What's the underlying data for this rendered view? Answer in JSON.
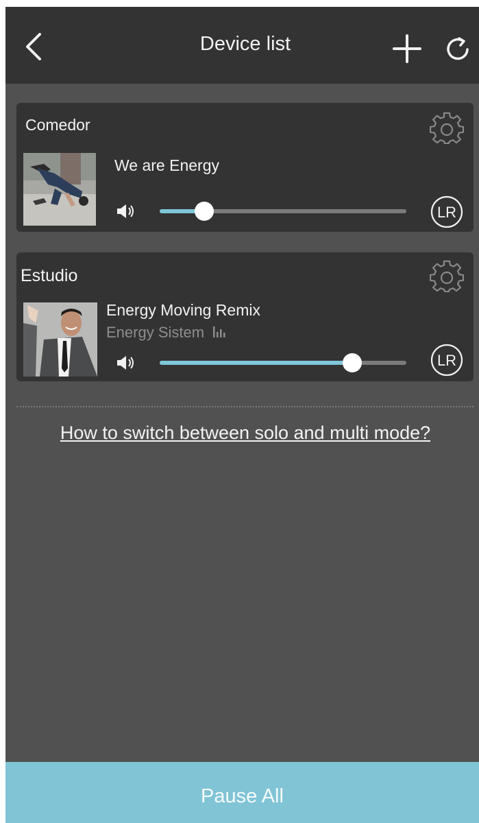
{
  "header": {
    "title": "Device list",
    "back_icon": "chevron-left-icon",
    "add_icon": "plus-icon",
    "refresh_icon": "refresh-icon"
  },
  "devices": [
    {
      "room": "Comedor",
      "track_title": "We are Energy",
      "artist": "",
      "volume": 0.18,
      "channel_label": "LR"
    },
    {
      "room": "Estudio",
      "track_title": "Energy Moving Remix",
      "artist": "Energy Sistem",
      "volume": 0.78,
      "channel_label": "LR"
    }
  ],
  "help_link": "How to switch between solo and multi mode?",
  "footer": {
    "pause_all_label": "Pause All"
  },
  "colors": {
    "header_bg": "#333333",
    "page_bg": "#515151",
    "card_bg": "#333333",
    "accent": "#80c4d6"
  }
}
